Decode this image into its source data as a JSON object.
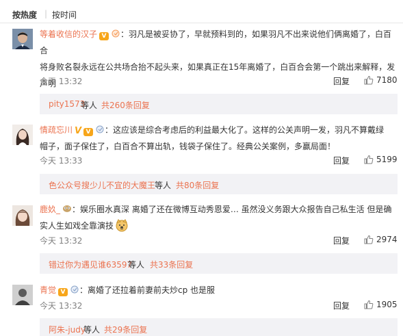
{
  "sort": {
    "hot": "按热度",
    "separator": "|",
    "time": "按时间"
  },
  "comments": [
    {
      "name": "等着收信的汉子",
      "text_line1": "：羽凡是被妥协了，早就预料到的，如果羽凡不出来说他们俩离婚了，白百合",
      "text_line2": "将身败名裂永远在公共场合抬不起头来，如果真正在15年离婚了，白百合会第一个跳出来解释，发",
      "text_line3": "声明",
      "time": "今天 13:32",
      "reply": "回复",
      "likes": "7180",
      "replies": {
        "users": "pity1573",
        "mid": " 等人 ",
        "link": "共260条回复"
      }
    },
    {
      "name": "情疏忘川",
      "text_line1": "：这应该是综合考虑后的利益最大化了。这样的公关声明一发，羽凡不算戴绿",
      "text_line2": "帽子，面子保住了，白百合不算出轨，钱袋子保住了。经典公关案例，多赢局面！",
      "time": "今天 13:33",
      "reply": "回复",
      "likes": "5199",
      "replies": {
        "users": "色公众号搜少儿不宜的大魔王",
        "mid": " 等人 ",
        "link": "共80条回复"
      }
    },
    {
      "name": "鹿奺_",
      "text_line1": "：娱乐圈水真深 离婚了还在微博互动秀恩爱… 虽然没义务跟大众报告自己私生活 但是确",
      "text_line2": "实人生如戏全靠演技",
      "time": "今天 13:32",
      "reply": "回复",
      "likes": "2974",
      "replies": {
        "users": "错过你为遇见谁63597",
        "mid": " 等人 ",
        "link": "共33条回复"
      }
    },
    {
      "name": "青觉",
      "text_line1": "：离婚了还拉着前妻前夫炒cp  也是服",
      "time": "今天 13:32",
      "reply": "回复",
      "likes": "1905",
      "replies": {
        "users": "阿朱-judy",
        "mid": " 等人 ",
        "link": "共29条回复"
      }
    }
  ],
  "colors": {
    "accent": "#eb7350",
    "text": "#333333",
    "muted": "#808080",
    "reply_bg": "#f2f2f5"
  }
}
